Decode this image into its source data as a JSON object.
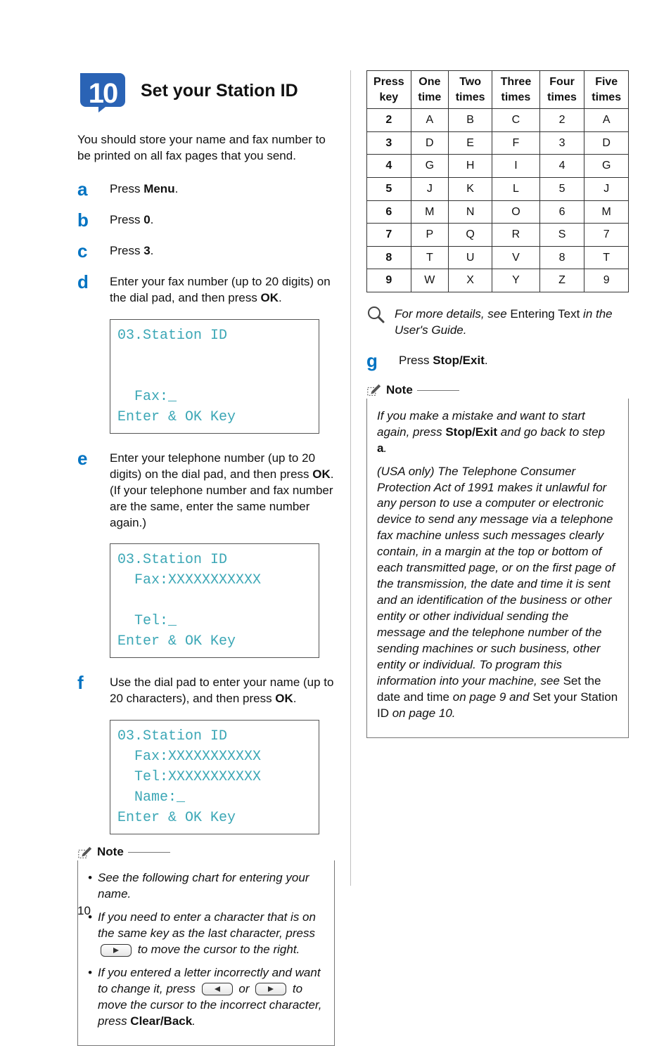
{
  "step_number": "10",
  "step_title": "Set your Station ID",
  "intro": "You should store your name and fax number to be printed on all fax pages that you send.",
  "steps": {
    "a": {
      "letter": "a",
      "text_pre": "Press ",
      "bold": "Menu",
      "text_post": "."
    },
    "b": {
      "letter": "b",
      "text_pre": "Press ",
      "bold": "0",
      "text_post": "."
    },
    "c": {
      "letter": "c",
      "text_pre": "Press ",
      "bold": "3",
      "text_post": "."
    },
    "d": {
      "letter": "d",
      "text": "Enter your fax number (up to 20 digits) on the dial pad, and then press ",
      "bold": "OK",
      "tail": ".",
      "lcd": "03.Station ID\n\n\n  Fax:_\nEnter & OK Key"
    },
    "e": {
      "letter": "e",
      "text": "Enter your telephone number (up to 20 digits) on the dial pad, and then press ",
      "bold": "OK",
      "tail": ". (If your telephone number and fax number are the same, enter the same number again.)",
      "lcd": "03.Station ID\n  Fax:XXXXXXXXXXX\n\n  Tel:_\nEnter & OK Key"
    },
    "f": {
      "letter": "f",
      "text": "Use the dial pad to enter your name (up to 20 characters), and then press ",
      "bold": "OK",
      "tail": ".",
      "lcd": "03.Station ID\n  Fax:XXXXXXXXXXX\n  Tel:XXXXXXXXXXX\n  Name:_\nEnter & OK Key"
    },
    "g": {
      "letter": "g",
      "text_pre": "Press ",
      "bold": "Stop/Exit",
      "text_post": "."
    }
  },
  "note_left": {
    "label": "Note",
    "b1": "See the following chart for entering your name.",
    "b2_a": "If you need to enter a character that is on the same key as the last character, press ",
    "b2_b": " to move the cursor to the right.",
    "b3_a": "If you entered a letter incorrectly and want to change it, press ",
    "b3_or": " or ",
    "b3_b": " to move the cursor to the incorrect character, press ",
    "b3_bold": "Clear/Back",
    "b3_c": "."
  },
  "table": {
    "headers": [
      "Press key",
      "One time",
      "Two times",
      "Three times",
      "Four times",
      "Five times"
    ],
    "rows": [
      [
        "2",
        "A",
        "B",
        "C",
        "2",
        "A"
      ],
      [
        "3",
        "D",
        "E",
        "F",
        "3",
        "D"
      ],
      [
        "4",
        "G",
        "H",
        "I",
        "4",
        "G"
      ],
      [
        "5",
        "J",
        "K",
        "L",
        "5",
        "J"
      ],
      [
        "6",
        "M",
        "N",
        "O",
        "6",
        "M"
      ],
      [
        "7",
        "P",
        "Q",
        "R",
        "S",
        "7"
      ],
      [
        "8",
        "T",
        "U",
        "V",
        "8",
        "T"
      ],
      [
        "9",
        "W",
        "X",
        "Y",
        "Z",
        "9"
      ]
    ]
  },
  "info": {
    "pre": "For more details, see ",
    "roman": "Entering Text",
    "mid": " in the User's Guide",
    "post": "."
  },
  "note_right": {
    "label": "Note",
    "p1_a": "If you make a mistake and want to start again, press ",
    "p1_bold": "Stop/Exit",
    "p1_b": " and go back to step ",
    "p1_bold2": "a",
    "p1_c": ".",
    "p2_a": "(USA only) The Telephone Consumer Protection Act of 1991 makes it unlawful for any person to use a computer or electronic device to send any message via a telephone fax machine unless such messages clearly contain, in a margin at the top or bottom of each transmitted page, or on the first page of the transmission, the date and time it is sent and an identification of the business or other entity or other individual sending the message and the telephone number of the sending machines or such business, other entity or individual. To program this information into your machine, see ",
    "p2_roman1": "Set the date and time",
    "p2_b": " on page 9 and ",
    "p2_roman2": "Set your Station ID",
    "p2_c": " on page 10."
  },
  "page_number": "10"
}
